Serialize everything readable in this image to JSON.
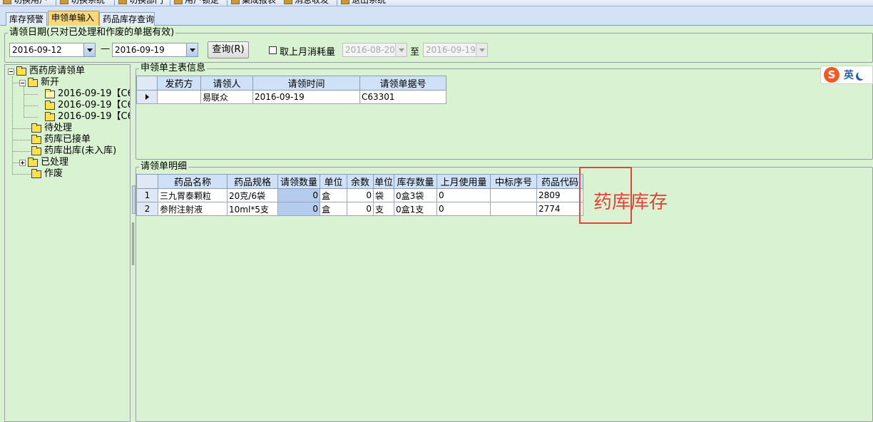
{
  "toolbar": {
    "items": [
      "切换用户",
      "切换系统",
      "切换部门",
      "用户锁定",
      "集成报表",
      "消息收发",
      "退出系统"
    ]
  },
  "tabs": [
    {
      "label": "库存预警",
      "active": false
    },
    {
      "label": "申领单输入",
      "active": true
    },
    {
      "label": "药品库存查询",
      "active": false
    }
  ],
  "filter": {
    "legend": "请领日期(只对已处理和作废的单据有效)",
    "date_from": "2016-09-12",
    "range_sep": "—",
    "date_to": "2016-09-19",
    "query_button": "查询(R)",
    "last_month_checkbox": {
      "label": "取上月消耗量",
      "checked": false
    },
    "last_from": "2016-08-20",
    "to_label": "至",
    "last_to": "2016-09-19"
  },
  "tree": {
    "root": "西药房请领单",
    "new_folder": "新开",
    "new_children": [
      "2016-09-19【C6",
      "2016-09-19【C6",
      "2016-09-19【C6"
    ],
    "pending": "待处理",
    "received": "药库已接单",
    "shipped": "药库出库(未入库)",
    "processed": "已处理",
    "voided": "作废"
  },
  "master": {
    "legend": "申领单主表信息",
    "columns": [
      "发药方",
      "请领人",
      "请领时间",
      "请领单据号"
    ],
    "rows": [
      {
        "dispenser": "",
        "requester": "易联众",
        "time": "2016-09-19",
        "doc_no": "C63301"
      }
    ]
  },
  "detail": {
    "legend": "请领单明细",
    "columns": [
      "药品名称",
      "药品规格",
      "请领数量",
      "单位",
      "余数",
      "单位",
      "库存数量",
      "上月使用量",
      "中标序号",
      "药品代码"
    ],
    "rows": [
      {
        "no": "1",
        "name": "三九胃泰颗粒",
        "spec": "20克/6袋",
        "qty": "0",
        "unit": "盒",
        "rem": "0",
        "unit2": "袋",
        "stock": "0盒3袋",
        "last_month": "0",
        "bid_no": "",
        "code": "2809"
      },
      {
        "no": "2",
        "name": "参附注射液",
        "spec": "10ml*5支",
        "qty": "0",
        "unit": "盒",
        "rem": "0",
        "unit2": "支",
        "stock": "0盒1支",
        "last_month": "0",
        "bid_no": "",
        "code": "2774"
      }
    ]
  },
  "annotation": {
    "text": "药库库存",
    "color": "#e0443a"
  },
  "ime": {
    "logo": "S",
    "mode": "英"
  },
  "colors": {
    "panel_bg": "#d9f3d2",
    "grid_header": "#cfe1f6",
    "selected_cell": "#b4cdef",
    "active_tab": "#f7d87c"
  }
}
